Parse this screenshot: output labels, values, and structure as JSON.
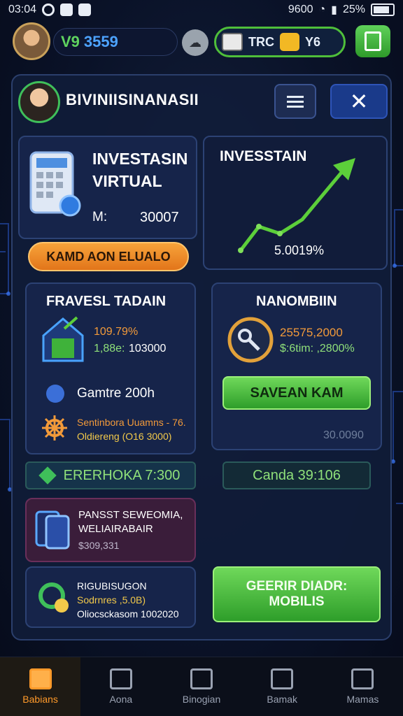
{
  "status_bar": {
    "time": "03:04",
    "right": "9600",
    "battery": "25%"
  },
  "header": {
    "currency_prefix": "V9",
    "currency_value": "3559",
    "pill_left": "TRC",
    "pill_right": "Y6"
  },
  "panel": {
    "title": "BIVINIISINANASII",
    "investment_card": {
      "title_line1": "INVESTASIN",
      "title_line2": "VIRTUAL",
      "m_label": "M:",
      "m_value": "30007",
      "button": "KAMD AON ELUALO"
    },
    "chart_card": {
      "title": "INVESSTAIN",
      "value": "5.0019%"
    },
    "farm_card": {
      "title": "FRAVESL TADAIN",
      "stat1": "109.79%",
      "stat2_label": "1,88e:",
      "stat2_value": "103000",
      "games_label": "Gamtre 200h",
      "note1": "Sentinbora Uuamns - 76.",
      "note2": "Oldiereng (O16 3000)"
    },
    "nanomb_card": {
      "title": "NANOMBIIN",
      "amount": "25575,2000",
      "sub": "$:6tim: ,2800%",
      "button": "SAVEAN KAM",
      "footer": "30.0090"
    },
    "strip_left": "ERERHOKA 7:300",
    "strip_right": "Canda 39:106",
    "mobile_card": {
      "line1": "PANSST SEWEOMIA,",
      "line2": "WELIAIRABAIR",
      "line3": "$309,331"
    },
    "reward_card": {
      "line1": "RIGUBISUGON",
      "line2": "Sodrnres ,5.0B)",
      "line3": "Oliocsckasom 1002020"
    },
    "cta_button_line1": "GEERIR DIADR:",
    "cta_button_line2": "MOBILIS"
  },
  "nav": [
    {
      "label": "Babians"
    },
    {
      "label": "Aona"
    },
    {
      "label": "Binogian"
    },
    {
      "label": "Bamak"
    },
    {
      "label": "Mamas"
    }
  ],
  "colors": {
    "accent_green": "#4fbf3a",
    "accent_orange": "#f7a33a",
    "accent_blue": "#4da3ff"
  }
}
